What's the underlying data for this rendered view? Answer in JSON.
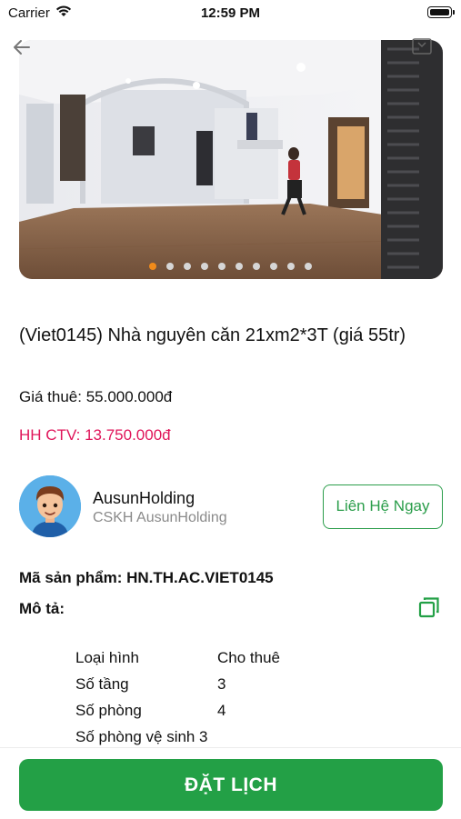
{
  "status_bar": {
    "carrier": "Carrier",
    "time": "12:59 PM"
  },
  "gallery": {
    "total_images": 10,
    "active_index": 0,
    "colors": {
      "active_dot": "#f28b1a",
      "dot": "#d6d6d6"
    }
  },
  "listing": {
    "title": "(Viet0145) Nhà nguyên căn 21xm2*3T (giá 55tr)",
    "price_text": "Giá thuê: 55.000.000đ",
    "commission_text": "HH CTV: 13.750.000đ"
  },
  "seller": {
    "name": "AusunHolding",
    "role": "CSKH AusunHolding",
    "contact_label": "Liên Hệ Ngay"
  },
  "product": {
    "code_label": "Mã sản phẩm:",
    "code_value": "HN.TH.AC.VIET0145",
    "description_label": "Mô tả:"
  },
  "specs": [
    {
      "key": "Loại hình",
      "value": "Cho thuê"
    },
    {
      "key": "Số tầng",
      "value": "3"
    },
    {
      "key": "Số phòng",
      "value": "4"
    },
    {
      "key": "Số phòng vệ sinh",
      "value": "3"
    }
  ],
  "actions": {
    "book_label": "ĐẶT LỊCH"
  },
  "colors": {
    "accent_green": "#23a046",
    "commission_pink": "#e0155a"
  }
}
